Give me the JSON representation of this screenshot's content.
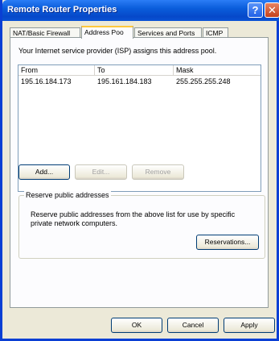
{
  "window": {
    "title": "Remote Router Properties",
    "help_glyph": "?",
    "close_glyph": "✕"
  },
  "tabs": [
    {
      "label": "NAT/Basic Firewall"
    },
    {
      "label": "Address Poo"
    },
    {
      "label": "Services and Ports"
    },
    {
      "label": "ICMP"
    }
  ],
  "address_pool": {
    "intro": "Your Internet service provider (ISP) assigns this address pool.",
    "columns": [
      "From",
      "To",
      "Mask"
    ],
    "rows": [
      {
        "from": "195.16.184.173",
        "to": "195.161.184.183",
        "mask": "255.255.255.248"
      }
    ],
    "add_label": "Add...",
    "edit_label": "Edit...",
    "remove_label": "Remove"
  },
  "reserve": {
    "legend": "Reserve public addresses",
    "description": "Reserve public addresses from the above list for use by specific private network computers.",
    "reservations_label": "Reservations..."
  },
  "footer": {
    "ok_label": "OK",
    "cancel_label": "Cancel",
    "apply_label": "Apply"
  }
}
